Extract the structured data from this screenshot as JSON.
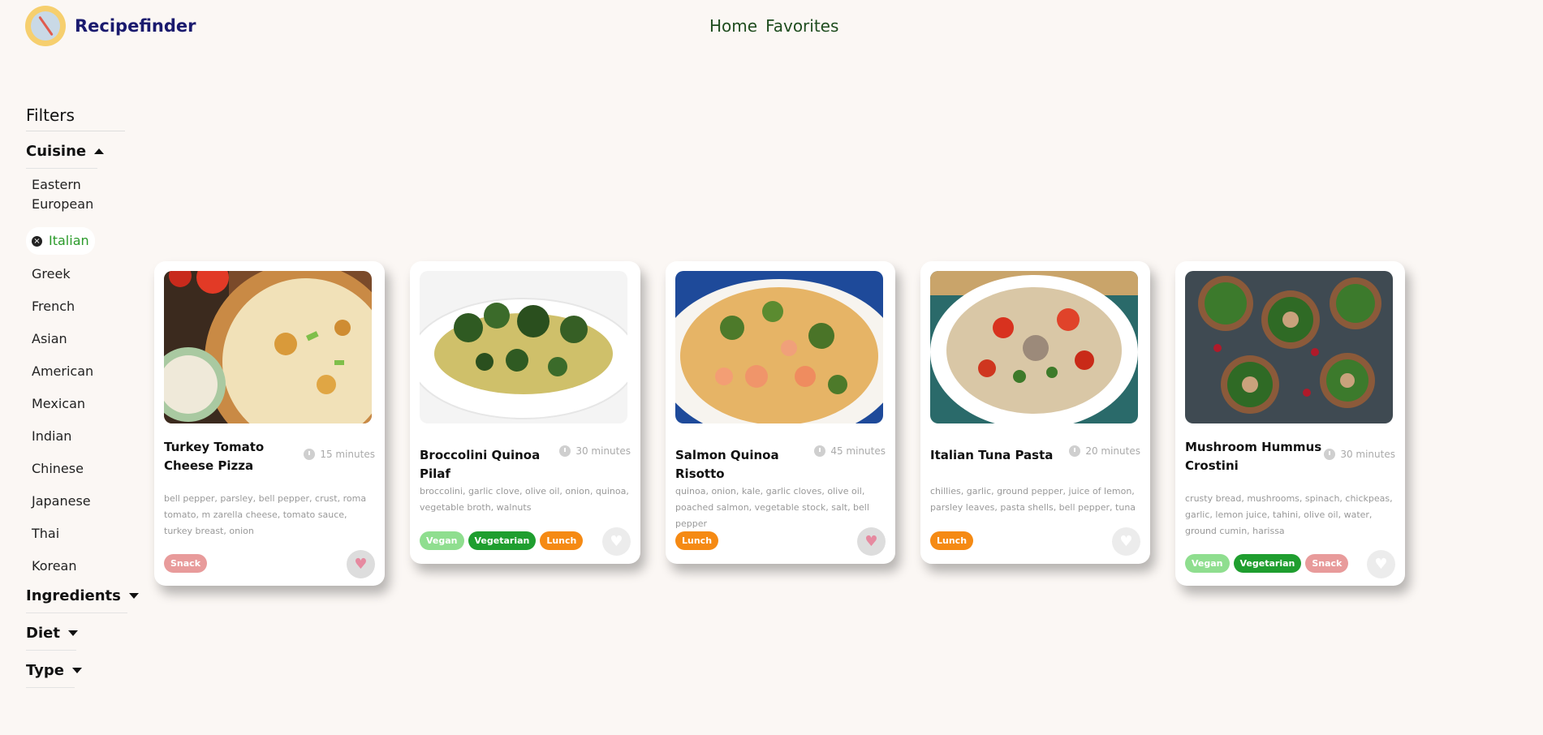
{
  "app": {
    "name": "Recipefinder"
  },
  "nav": {
    "home": "Home",
    "favorites": "Favorites"
  },
  "sidebar": {
    "title": "Filters",
    "cuisine": {
      "label": "Cuisine",
      "items": [
        "Eastern European",
        "Italian",
        "Greek",
        "French",
        "Asian",
        "American",
        "Mexican",
        "Indian",
        "Chinese",
        "Japanese",
        "Thai",
        "Korean"
      ],
      "selected": "Italian"
    },
    "ingredients": {
      "label": "Ingredients"
    },
    "diet": {
      "label": "Diet"
    },
    "type": {
      "label": "Type"
    }
  },
  "cards": [
    {
      "title": "Turkey Tomato Cheese Pizza",
      "time": "15 minutes",
      "ingredients": "bell pepper, parsley, bell pepper, crust, roma tomato, m zarella cheese, tomato sauce, turkey breast, onion",
      "tags": [
        "Snack"
      ],
      "favorite": true
    },
    {
      "title": "Broccolini Quinoa Pilaf",
      "time": "30 minutes",
      "ingredients": "broccolini, garlic clove, olive oil, onion, quinoa, vegetable broth, walnuts",
      "tags": [
        "Vegan",
        "Vegetarian",
        "Lunch"
      ],
      "favorite": false
    },
    {
      "title": "Salmon Quinoa Risotto",
      "time": "45 minutes",
      "ingredients": "quinoa, onion, kale, garlic cloves, olive oil, poached salmon, vegetable stock, salt, bell pepper",
      "tags": [
        "Lunch"
      ],
      "favorite": true
    },
    {
      "title": "Italian Tuna Pasta",
      "time": "20 minutes",
      "ingredients": "chillies, garlic, ground pepper, juice of lemon, parsley leaves, pasta shells, bell pepper, tuna",
      "tags": [
        "Lunch"
      ],
      "favorite": false
    },
    {
      "title": "Mushroom Hummus Crostini",
      "time": "30 minutes",
      "ingredients": "crusty bread, mushrooms, spinach, chickpeas, garlic, lemon juice, tahini, olive oil, water, ground cumin, harissa",
      "tags": [
        "Vegan",
        "Vegetarian",
        "Snack"
      ],
      "favorite": false
    }
  ],
  "colors": {
    "brand": "#1a1a6e",
    "nav": "#1f4d1f",
    "selected": "#2a9a2a",
    "vegan": "#8fde8f",
    "vegetarian": "#1f9e2f",
    "lunch": "#f58a14",
    "snack": "#e89b9b"
  },
  "icons": [
    "logo-icon",
    "clock-icon",
    "heart-icon",
    "clear-icon",
    "caret-up-icon",
    "caret-down-icon"
  ]
}
